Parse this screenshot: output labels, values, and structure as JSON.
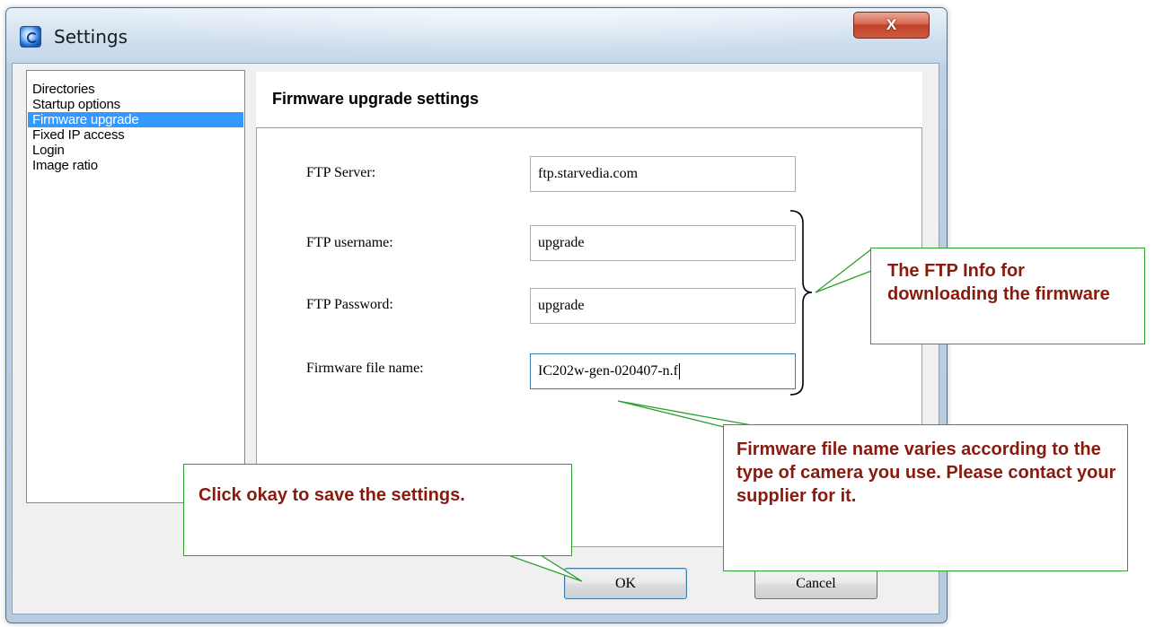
{
  "window": {
    "title": "Settings",
    "close_label": "X"
  },
  "sidebar": {
    "items": [
      {
        "label": "Directories",
        "selected": false
      },
      {
        "label": "Startup options",
        "selected": false
      },
      {
        "label": "Firmware upgrade",
        "selected": true
      },
      {
        "label": "Fixed IP access",
        "selected": false
      },
      {
        "label": "Login",
        "selected": false
      },
      {
        "label": "Image ratio",
        "selected": false
      }
    ]
  },
  "main": {
    "title": "Firmware upgrade settings",
    "fields": {
      "ftp_server": {
        "label": "FTP Server:",
        "value": "ftp.starvedia.com"
      },
      "ftp_username": {
        "label": "FTP username:",
        "value": "upgrade"
      },
      "ftp_password": {
        "label": "FTP Password:",
        "value": "upgrade"
      },
      "firmware_file": {
        "label": "Firmware file name:",
        "value": "IC202w-gen-020407-n.f"
      }
    }
  },
  "buttons": {
    "ok": "OK",
    "cancel": "Cancel"
  },
  "callouts": {
    "ftp_info": "The FTP Info for downloading the firmware",
    "firmware_name": "Firmware file name varies according to the type of camera you use. Please contact your supplier for it.",
    "click_ok": "Click okay to save the settings."
  },
  "colors": {
    "callout_border": "#2ea02e",
    "callout_text": "#8a1a0e",
    "selection": "#3399ff"
  }
}
